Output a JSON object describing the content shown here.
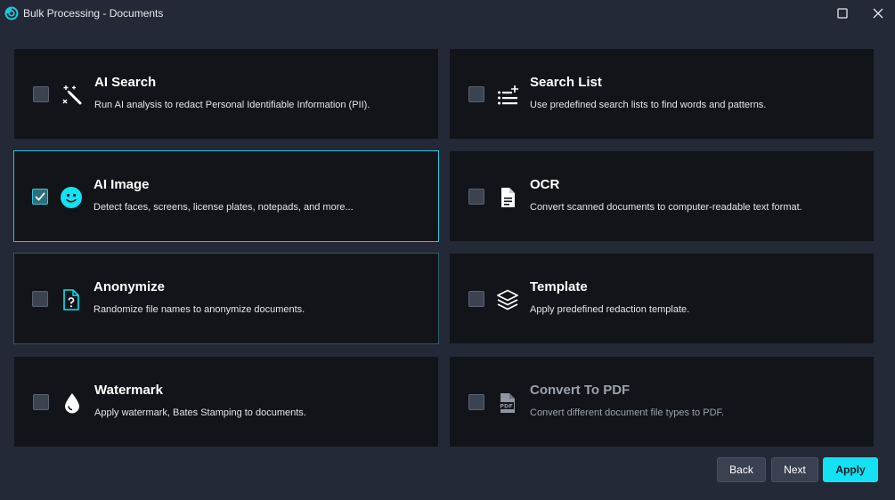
{
  "window": {
    "title": "Bulk Processing - Documents"
  },
  "options": [
    {
      "title": "AI Search",
      "description": "Run AI analysis to redact Personal Identifiable Information (PII).",
      "checked": false,
      "icon": "magic-wand-icon"
    },
    {
      "title": "Search List",
      "description": "Use predefined search lists to find words and patterns.",
      "checked": false,
      "icon": "list-sparkle-icon"
    },
    {
      "title": "AI Image",
      "description": "Detect faces, screens, license plates, notepads, and more...",
      "checked": true,
      "icon": "smiley-face-icon"
    },
    {
      "title": "OCR",
      "description": "Convert scanned documents to computer-readable text format.",
      "checked": false,
      "icon": "document-icon"
    },
    {
      "title": "Anonymize",
      "description": "Randomize file names to anonymize documents.",
      "checked": false,
      "icon": "file-question-icon"
    },
    {
      "title": "Template",
      "description": "Apply predefined redaction template.",
      "checked": false,
      "icon": "layers-icon"
    },
    {
      "title": "Watermark",
      "description": "Apply watermark, Bates Stamping to documents.",
      "checked": false,
      "icon": "water-drop-icon"
    },
    {
      "title": "Convert To PDF",
      "description": "Convert different document file types to PDF.",
      "checked": false,
      "disabled": true,
      "icon": "pdf-file-icon"
    }
  ],
  "buttons": {
    "back": "Back",
    "next": "Next",
    "apply": "Apply"
  },
  "colors": {
    "accent": "#12e2f2",
    "selected_border": "#27c5d9",
    "card_bg": "#121419",
    "window_bg": "#232936"
  }
}
